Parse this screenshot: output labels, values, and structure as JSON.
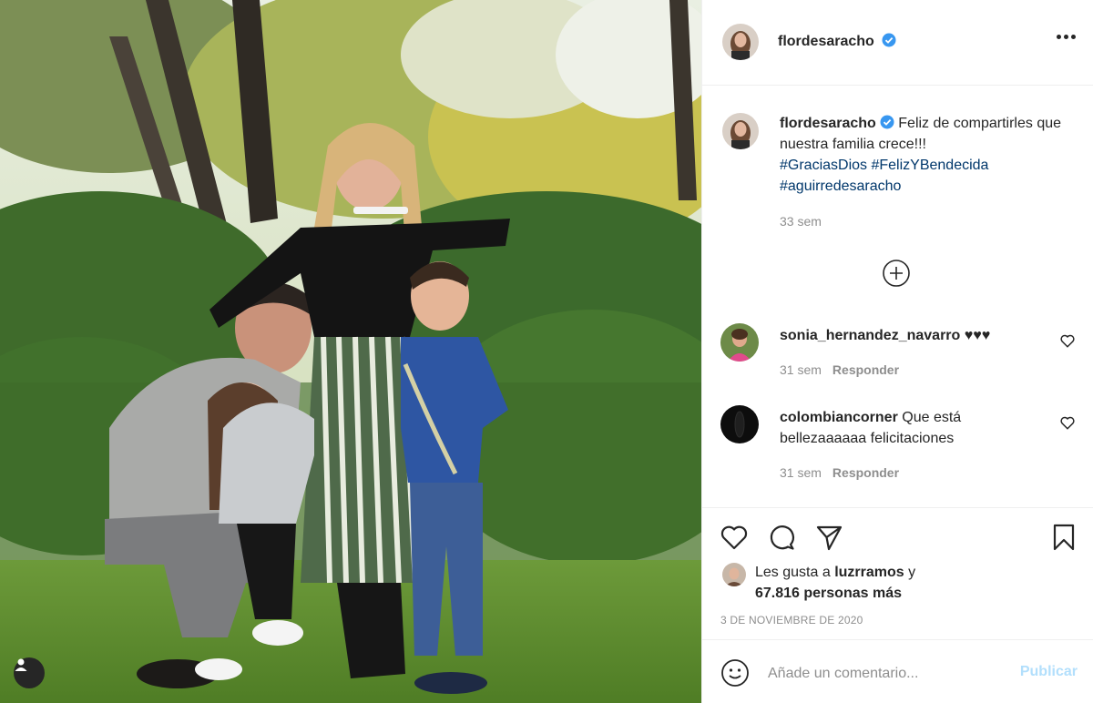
{
  "post": {
    "author": "flordesaracho",
    "verified": true,
    "image_alt": "Family photo in a garden with a pregnancy test",
    "tag_icon": "user-tag-icon"
  },
  "header": {
    "username": "flordesaracho",
    "more_icon": "more-options-icon"
  },
  "caption": {
    "username": "flordesaracho",
    "text": "Feliz de compartirles que nuestra familia crece!!!",
    "hashtags": [
      "#GraciasDios",
      "#FelizYBendecida",
      "#aguirredesaracho"
    ],
    "time": "33 sem"
  },
  "comments": [
    {
      "username": "sonia_hernandez_navarro",
      "text": "♥♥♥",
      "time": "31 sem",
      "reply_label": "Responder"
    },
    {
      "username": "colombiancorner",
      "text": "Que está bellezaaaaaa felicitaciones",
      "time": "31 sem",
      "reply_label": "Responder"
    }
  ],
  "actions": {
    "likes_prefix": "Les gusta a",
    "liked_by": "luzrramos",
    "likes_connector": "y",
    "likes_count": "67.816 personas más",
    "date": "3 DE NOVIEMBRE DE 2020"
  },
  "comment_box": {
    "placeholder": "Añade un comentario...",
    "publish_label": "Publicar"
  },
  "colors": {
    "link": "#00376b",
    "verified": "#3897f0",
    "muted": "#8e8e8e",
    "publish_disabled": "#b2dffc"
  }
}
